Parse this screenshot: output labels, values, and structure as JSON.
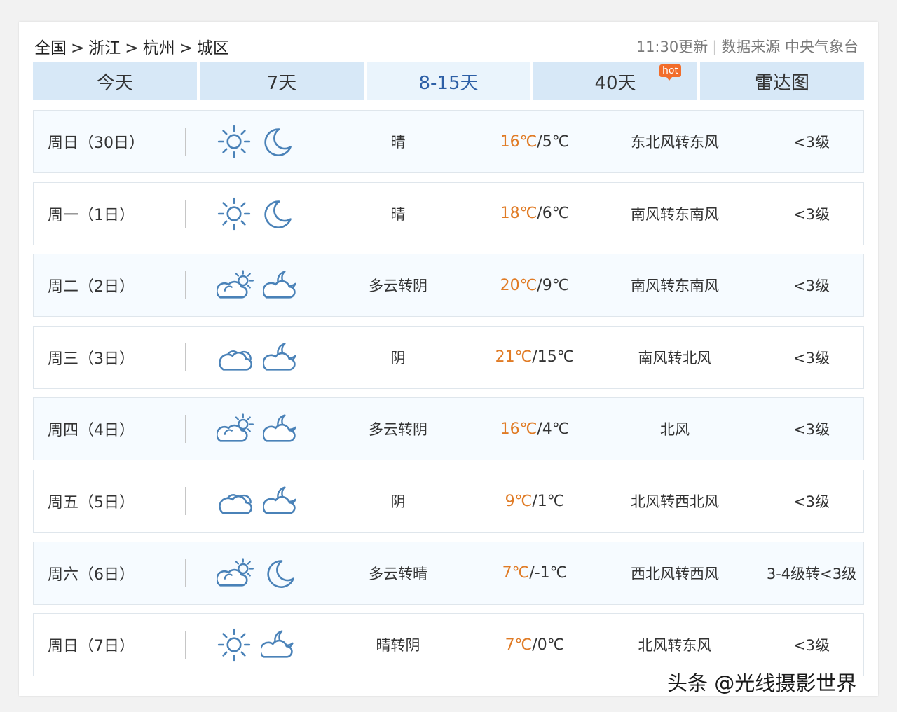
{
  "breadcrumb": [
    "全国",
    "浙江",
    "杭州",
    "城区"
  ],
  "breadcrumb_sep": ">",
  "update": {
    "time": "11:30更新",
    "divider": "|",
    "source": "数据来源 中央气象台"
  },
  "tabs": [
    {
      "label": "今天",
      "active": false
    },
    {
      "label": "7天",
      "active": false
    },
    {
      "label": "8-15天",
      "active": true
    },
    {
      "label": "40天",
      "active": false,
      "badge": "hot"
    },
    {
      "label": "雷达图",
      "active": false
    }
  ],
  "temp_sep": "/",
  "forecast": [
    {
      "day": "周日（30日）",
      "icon_day": "sun-icon",
      "icon_night": "moon-icon",
      "desc": "晴",
      "high": "16℃",
      "low": "5℃",
      "wind": "东北风转东风",
      "level": "<3级"
    },
    {
      "day": "周一（1日）",
      "icon_day": "sun-icon",
      "icon_night": "moon-icon",
      "desc": "晴",
      "high": "18℃",
      "low": "6℃",
      "wind": "南风转东南风",
      "level": "<3级"
    },
    {
      "day": "周二（2日）",
      "icon_day": "partly-cloudy-day-icon",
      "icon_night": "cloudy-night-icon",
      "desc": "多云转阴",
      "high": "20℃",
      "low": "9℃",
      "wind": "南风转东南风",
      "level": "<3级"
    },
    {
      "day": "周三（3日）",
      "icon_day": "cloud-icon",
      "icon_night": "cloudy-night-icon",
      "desc": "阴",
      "high": "21℃",
      "low": "15℃",
      "wind": "南风转北风",
      "level": "<3级"
    },
    {
      "day": "周四（4日）",
      "icon_day": "partly-cloudy-day-icon",
      "icon_night": "cloudy-night-icon",
      "desc": "多云转阴",
      "high": "16℃",
      "low": "4℃",
      "wind": "北风",
      "level": "<3级"
    },
    {
      "day": "周五（5日）",
      "icon_day": "cloud-icon",
      "icon_night": "cloudy-night-icon",
      "desc": "阴",
      "high": "9℃",
      "low": "1℃",
      "wind": "北风转西北风",
      "level": "<3级"
    },
    {
      "day": "周六（6日）",
      "icon_day": "partly-cloudy-day-icon",
      "icon_night": "moon-icon",
      "desc": "多云转晴",
      "high": "7℃",
      "low": "-1℃",
      "wind": "西北风转西风",
      "level": "3-4级转<3级"
    },
    {
      "day": "周日（7日）",
      "icon_day": "sun-icon",
      "icon_night": "cloudy-night-icon",
      "desc": "晴转阴",
      "high": "7℃",
      "low": "0℃",
      "wind": "北风转东风",
      "level": "<3级"
    }
  ],
  "colors": {
    "tab_bg": "#d7e8f7",
    "tab_active_bg": "#eaf4fc",
    "tab_active_text": "#2d5fa6",
    "high_temp": "#e07b25",
    "icon_stroke": "#4a82b8",
    "hot_badge": "#f26d2b"
  },
  "watermark": "头条 @光线摄影世界"
}
